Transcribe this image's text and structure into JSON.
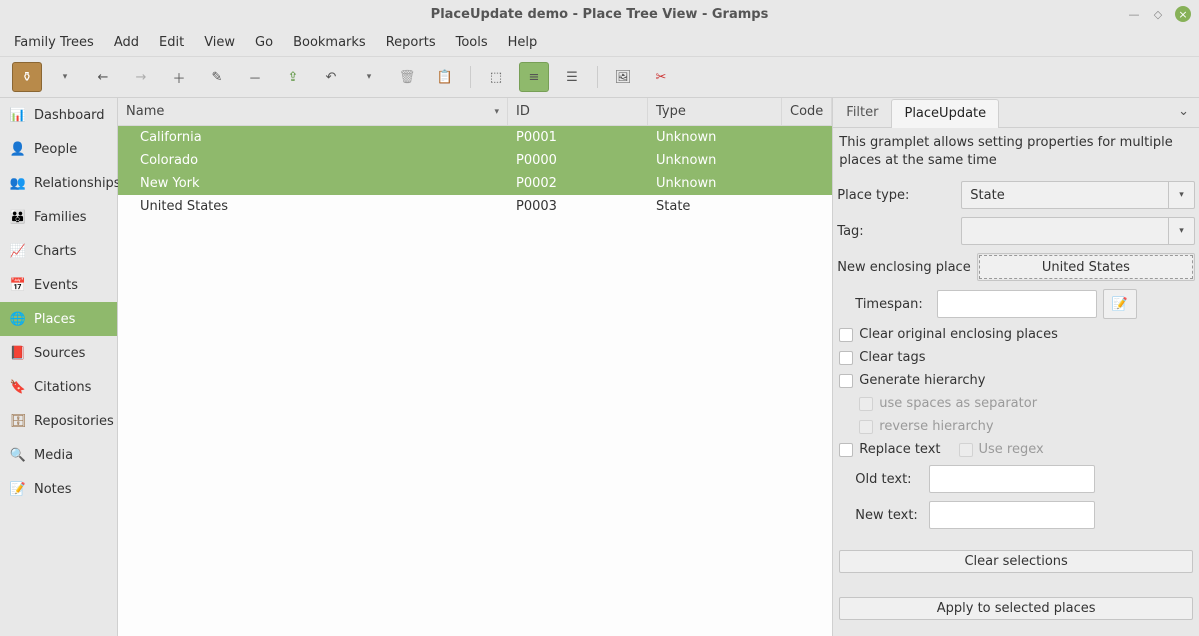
{
  "window": {
    "title": "PlaceUpdate demo - Place Tree View - Gramps"
  },
  "menu": {
    "family_trees": "Family Trees",
    "add": "Add",
    "edit": "Edit",
    "view": "View",
    "go": "Go",
    "bookmarks": "Bookmarks",
    "reports": "Reports",
    "tools": "Tools",
    "help": "Help"
  },
  "sidebar": {
    "items": [
      {
        "label": "Dashboard"
      },
      {
        "label": "People"
      },
      {
        "label": "Relationships"
      },
      {
        "label": "Families"
      },
      {
        "label": "Charts"
      },
      {
        "label": "Events"
      },
      {
        "label": "Places"
      },
      {
        "label": "Sources"
      },
      {
        "label": "Citations"
      },
      {
        "label": "Repositories"
      },
      {
        "label": "Media"
      },
      {
        "label": "Notes"
      }
    ]
  },
  "table": {
    "headers": {
      "name": "Name",
      "id": "ID",
      "type": "Type",
      "code": "Code"
    },
    "rows": [
      {
        "name": "California",
        "id": "P0001",
        "type": "Unknown",
        "selected": true
      },
      {
        "name": "Colorado",
        "id": "P0000",
        "type": "Unknown",
        "selected": true
      },
      {
        "name": "New York",
        "id": "P0002",
        "type": "Unknown",
        "selected": true
      },
      {
        "name": "United States",
        "id": "P0003",
        "type": "State",
        "selected": false
      }
    ]
  },
  "panel": {
    "tabs": {
      "filter": "Filter",
      "placeupdate": "PlaceUpdate"
    },
    "description": "This gramplet allows setting properties for multiple places at the same time",
    "labels": {
      "place_type": "Place type:",
      "tag": "Tag:",
      "new_enclosing": "New enclosing place",
      "timespan": "Timespan:",
      "clear_enclosing": "Clear original enclosing places",
      "clear_tags": "Clear tags",
      "generate_hierarchy": "Generate hierarchy",
      "use_spaces": "use spaces as separator",
      "reverse_hierarchy": "reverse hierarchy",
      "replace_text": "Replace text",
      "use_regex": "Use regex",
      "old_text": "Old text:",
      "new_text": "New text:",
      "clear_selections": "Clear selections",
      "apply": "Apply to selected places"
    },
    "values": {
      "place_type": "State",
      "tag": "",
      "enclosing_place": "United States",
      "timespan": ""
    }
  }
}
